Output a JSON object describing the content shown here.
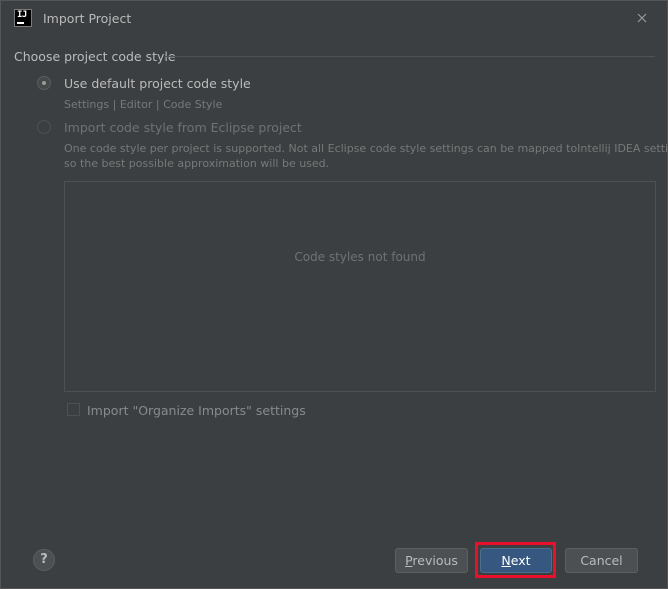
{
  "window": {
    "title": "Import Project",
    "app_icon_text": "IJ"
  },
  "section": {
    "title": "Choose project code style"
  },
  "options": {
    "default": {
      "label": "Use default project code style",
      "hint": "Settings | Editor | Code Style",
      "selected": true
    },
    "eclipse": {
      "label": "Import code style from Eclipse project",
      "hint_line1": "One code style per project is supported. Not all Eclipse code style settings can be mapped toIntellij IDEA settings,",
      "hint_line2": "so the best possible approximation will be used.",
      "selected": false,
      "enabled": false
    }
  },
  "panel": {
    "empty_text": "Code styles not found"
  },
  "organize_imports": {
    "label": "Import \"Organize Imports\" settings",
    "checked": false
  },
  "footer": {
    "help": "?",
    "previous_mnemonic": "P",
    "previous_rest": "revious",
    "next_mnemonic": "N",
    "next_rest": "ext",
    "cancel": "Cancel"
  },
  "colors": {
    "background": "#3c3f41",
    "default_button": "#365880",
    "highlight": "#e8102a"
  }
}
